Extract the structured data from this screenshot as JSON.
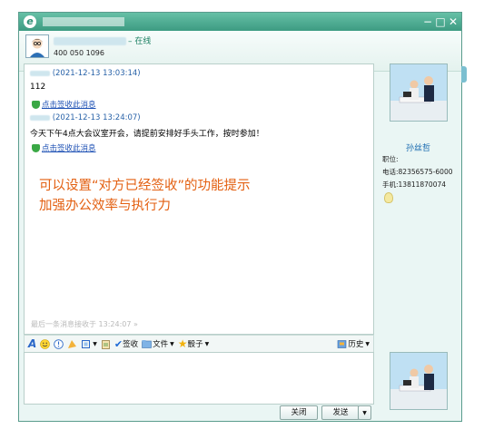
{
  "window": {
    "status": "– 在线",
    "contact_id": "400 050 1096",
    "controls": {
      "minimize": "−",
      "maximize": "□",
      "close": "✕"
    }
  },
  "messages": [
    {
      "timestamp": "(2021-12-13 13:03:14)",
      "text": "112",
      "receipt_link": "点击签收此消息"
    },
    {
      "timestamp": "(2021-12-13 13:24:07)",
      "text": "今天下午4点大会议室开会，请提前安排好手头工作，按时参加！",
      "receipt_link": "点击签收此消息"
    }
  ],
  "promo": {
    "line1": "可以设置“对方已经签收”的功能提示",
    "line2": "加强办公效率与执行力"
  },
  "last_received_note": "最后一条消息接收于 13:24:07 »",
  "toolbar": {
    "sign_label": "签收",
    "file_label": "文件",
    "dice_label": "骰子",
    "history_label": "历史"
  },
  "buttons": {
    "close": "关闭",
    "send": "发送"
  },
  "profile": {
    "name": "孙丝哲",
    "title_label": "职位:",
    "phone": "电话:82356575-6000",
    "mobile": "手机:13811870074"
  }
}
